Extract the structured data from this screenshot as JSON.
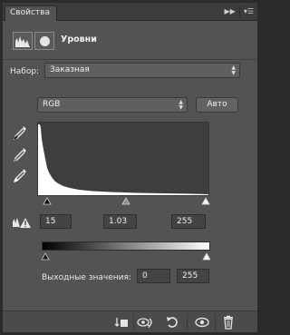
{
  "tab": {
    "label": "Свойства"
  },
  "header": {
    "title": "Уровни"
  },
  "preset": {
    "label": "Набор:",
    "value": "Заказная"
  },
  "channel": {
    "value": "RGB"
  },
  "auto_button": {
    "label": "Авто"
  },
  "input_levels": {
    "black": "15",
    "gamma": "1.03",
    "white": "255"
  },
  "output": {
    "label": "Выходные значения:",
    "black": "0",
    "white": "255"
  },
  "icons": {
    "panel_expand": "double-arrow-right-icon",
    "panel_menu": "menu-icon",
    "adjustment": "levels-histogram-icon",
    "mask": "layer-mask-icon",
    "black_eyedropper": "eyedropper-black-icon",
    "gray_eyedropper": "eyedropper-gray-icon",
    "white_eyedropper": "eyedropper-white-icon",
    "clipping_warning": "clipping-warning-icon",
    "clip_to_layer": "clip-to-layer-icon",
    "view_previous": "view-previous-state-icon",
    "reset": "reset-icon",
    "visibility": "eye-icon",
    "delete": "trash-icon"
  },
  "colors": {
    "panel_bg": "#535353",
    "histogram_bg": "#3e3e3e",
    "histogram_fill": "#ffffff"
  }
}
